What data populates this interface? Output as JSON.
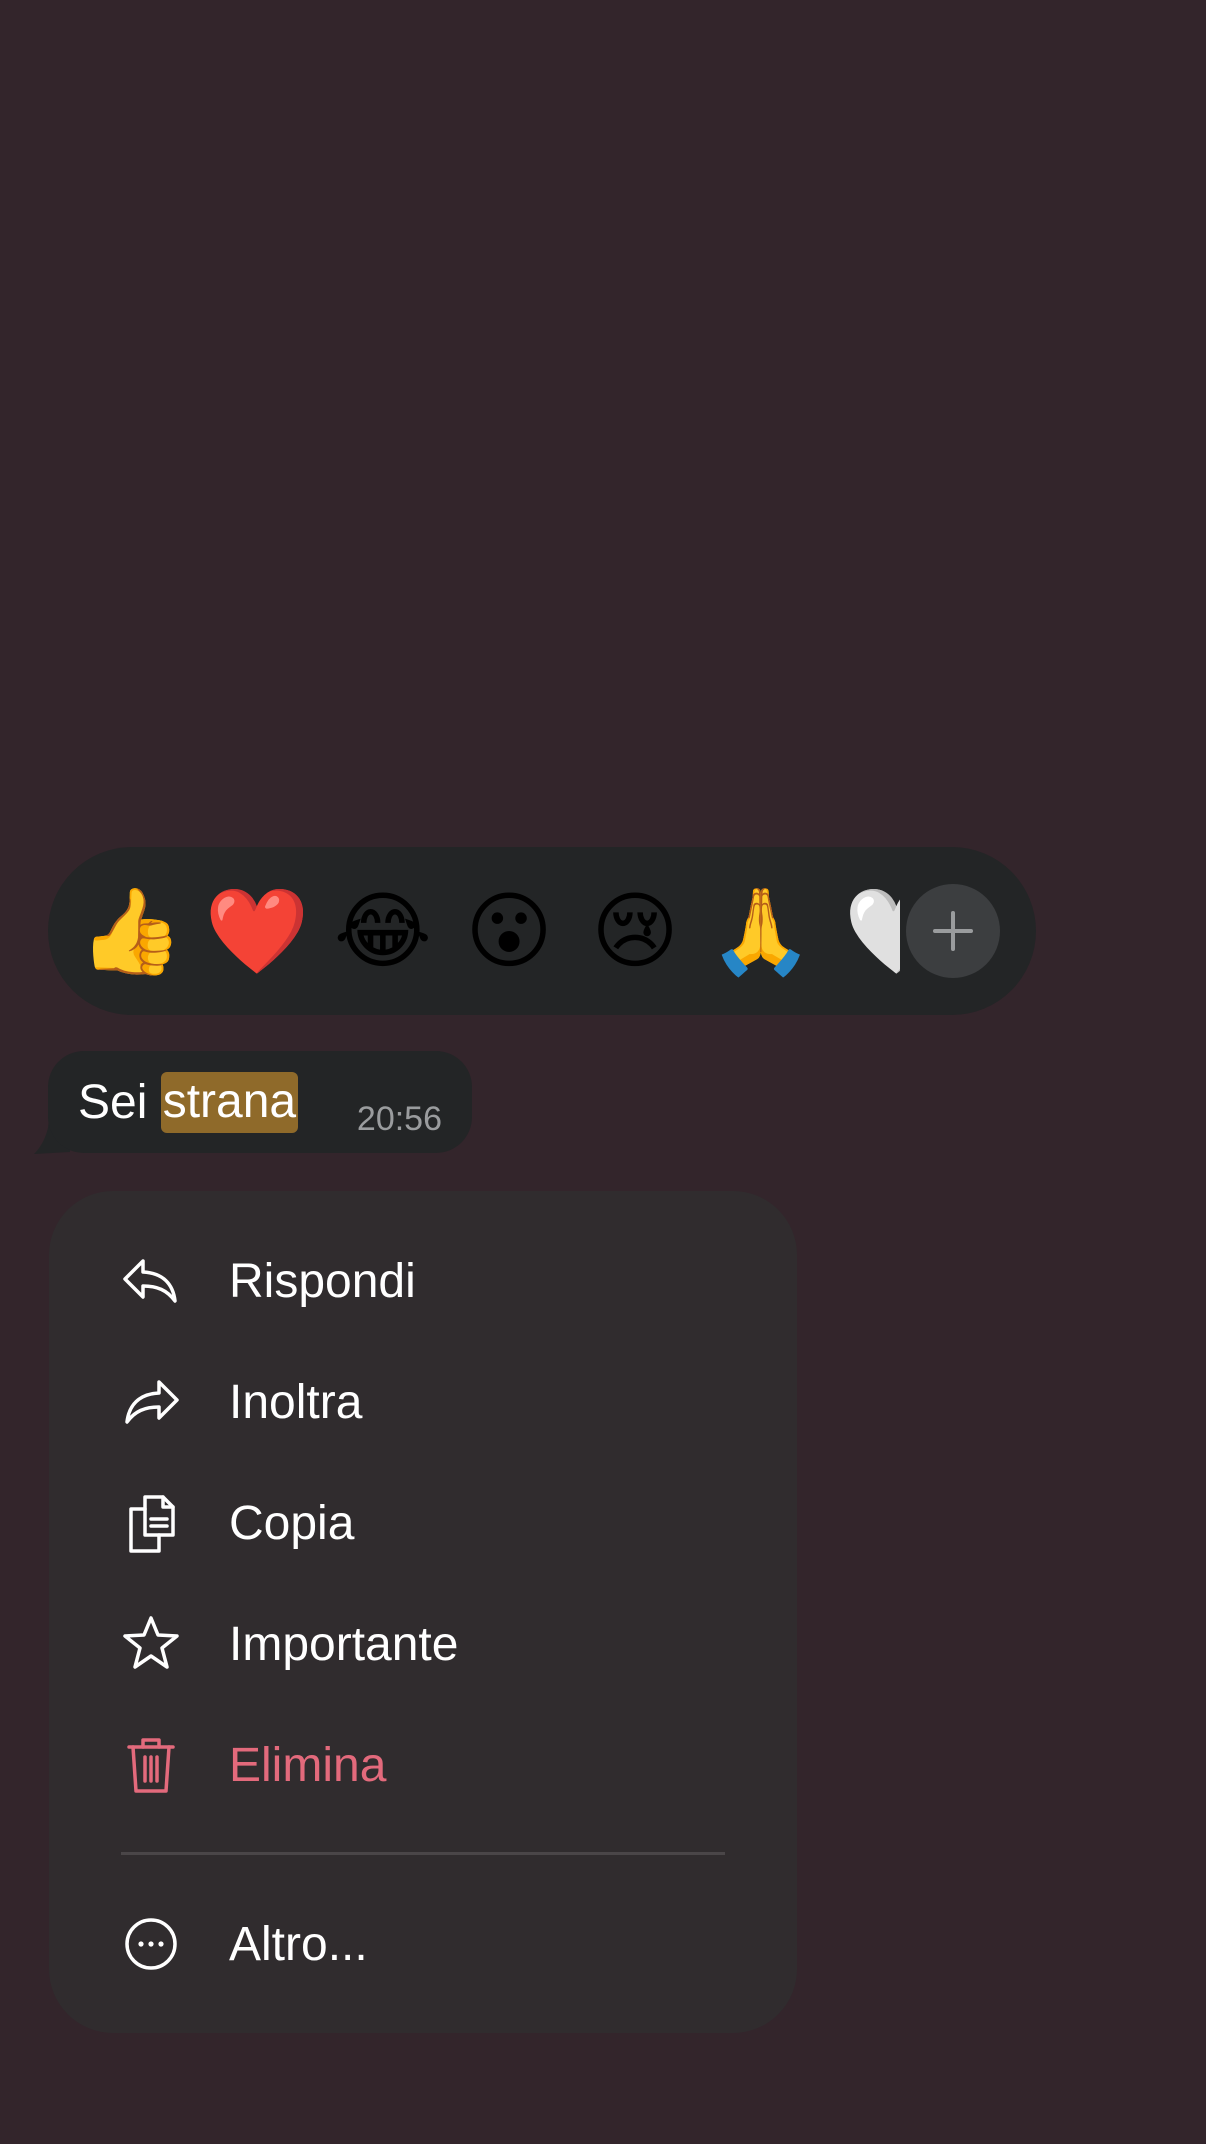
{
  "reactions": {
    "emojis": [
      {
        "name": "thumbs-up",
        "glyph": "👍"
      },
      {
        "name": "red-heart",
        "glyph": "❤️"
      },
      {
        "name": "tears-of-joy",
        "glyph": "😂"
      },
      {
        "name": "surprised",
        "glyph": "😮"
      },
      {
        "name": "crying",
        "glyph": "😢"
      },
      {
        "name": "folded-hands",
        "glyph": "🙏"
      },
      {
        "name": "white-heart",
        "glyph": "🤍"
      }
    ],
    "more_icon": "plus-icon"
  },
  "message": {
    "text_before": "Sei ",
    "highlighted_text": "strana",
    "time": "20:56"
  },
  "menu": {
    "items": [
      {
        "label": "Rispondi",
        "icon": "reply-icon"
      },
      {
        "label": "Inoltra",
        "icon": "forward-icon"
      },
      {
        "label": "Copia",
        "icon": "copy-icon"
      },
      {
        "label": "Importante",
        "icon": "star-icon"
      },
      {
        "label": "Elimina",
        "icon": "trash-icon",
        "danger": true
      }
    ],
    "more": {
      "label": "Altro...",
      "icon": "more-icon"
    }
  },
  "colors": {
    "background": "#33252b",
    "bubble": "#232526",
    "menu": "#302c2e",
    "highlight": "#8f6a2a",
    "danger": "#e36a7c"
  }
}
